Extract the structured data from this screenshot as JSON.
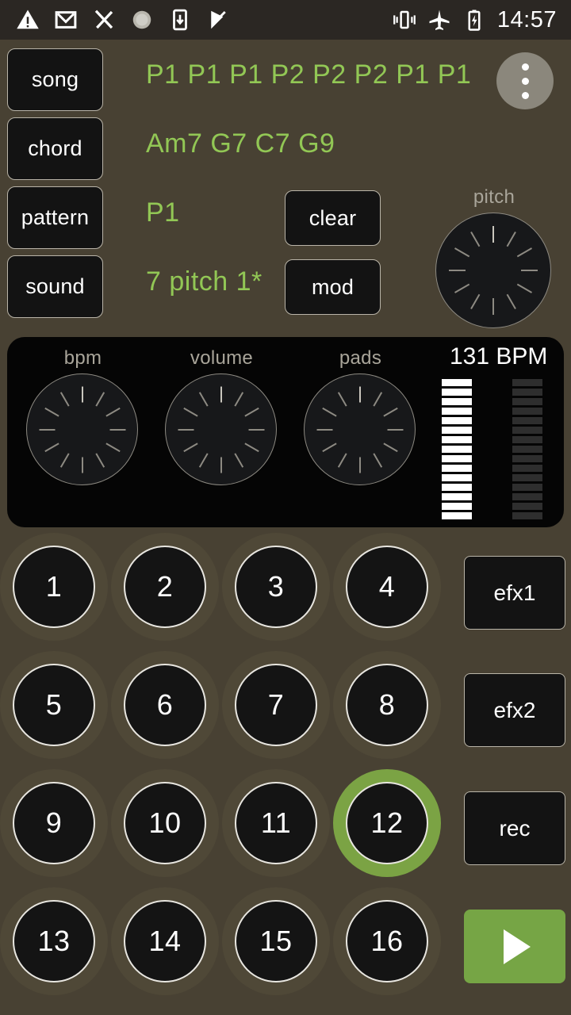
{
  "statusbar": {
    "time": "14:57",
    "left_icons": [
      "warning-triangle-icon",
      "gmail-icon",
      "scissors-icon",
      "loading-circle-icon",
      "download-to-phone-icon",
      "checkmark-flag-icon"
    ],
    "right_icons": [
      "vibrate-icon",
      "airplane-mode-icon",
      "battery-charging-icon"
    ]
  },
  "controls": {
    "song_label": "song",
    "song_value": "P1 P1 P1 P2 P2 P2 P1 P1",
    "chord_label": "chord",
    "chord_value": "Am7 G7 C7 G9",
    "pattern_label": "pattern",
    "pattern_value": "P1",
    "sound_label": "sound",
    "sound_value": "7 pitch 1*",
    "clear_label": "clear",
    "mod_label": "mod",
    "menu_label": "overflow-menu"
  },
  "pitch_knob": {
    "label": "pitch",
    "ticks": 12,
    "active_tick": 0
  },
  "panel": {
    "bpm_label": "bpm",
    "volume_label": "volume",
    "pads_label": "pads",
    "bpm_readout": "131 BPM",
    "knob_ticks": 12,
    "meter_left_segments": 15,
    "meter_left_lit": 15,
    "meter_right_segments": 15,
    "meter_right_lit": 0
  },
  "pads": [
    {
      "label": "1",
      "active": false
    },
    {
      "label": "2",
      "active": false
    },
    {
      "label": "3",
      "active": false
    },
    {
      "label": "4",
      "active": false
    },
    {
      "label": "5",
      "active": false
    },
    {
      "label": "6",
      "active": false
    },
    {
      "label": "7",
      "active": false
    },
    {
      "label": "8",
      "active": false
    },
    {
      "label": "9",
      "active": false
    },
    {
      "label": "10",
      "active": false
    },
    {
      "label": "11",
      "active": false
    },
    {
      "label": "12",
      "active": true
    },
    {
      "label": "13",
      "active": false
    },
    {
      "label": "14",
      "active": false
    },
    {
      "label": "15",
      "active": false
    },
    {
      "label": "16",
      "active": false
    }
  ],
  "side_buttons": {
    "efx1_label": "efx1",
    "efx2_label": "efx2",
    "rec_label": "rec",
    "play_label": "play"
  },
  "colors": {
    "background": "#484133",
    "panel": "#050505",
    "accent_green": "#92c755",
    "play_green": "#76a545",
    "pad_active_ring": "#7ba344",
    "button_fill": "#131313",
    "statusbar": "#2b2723"
  }
}
